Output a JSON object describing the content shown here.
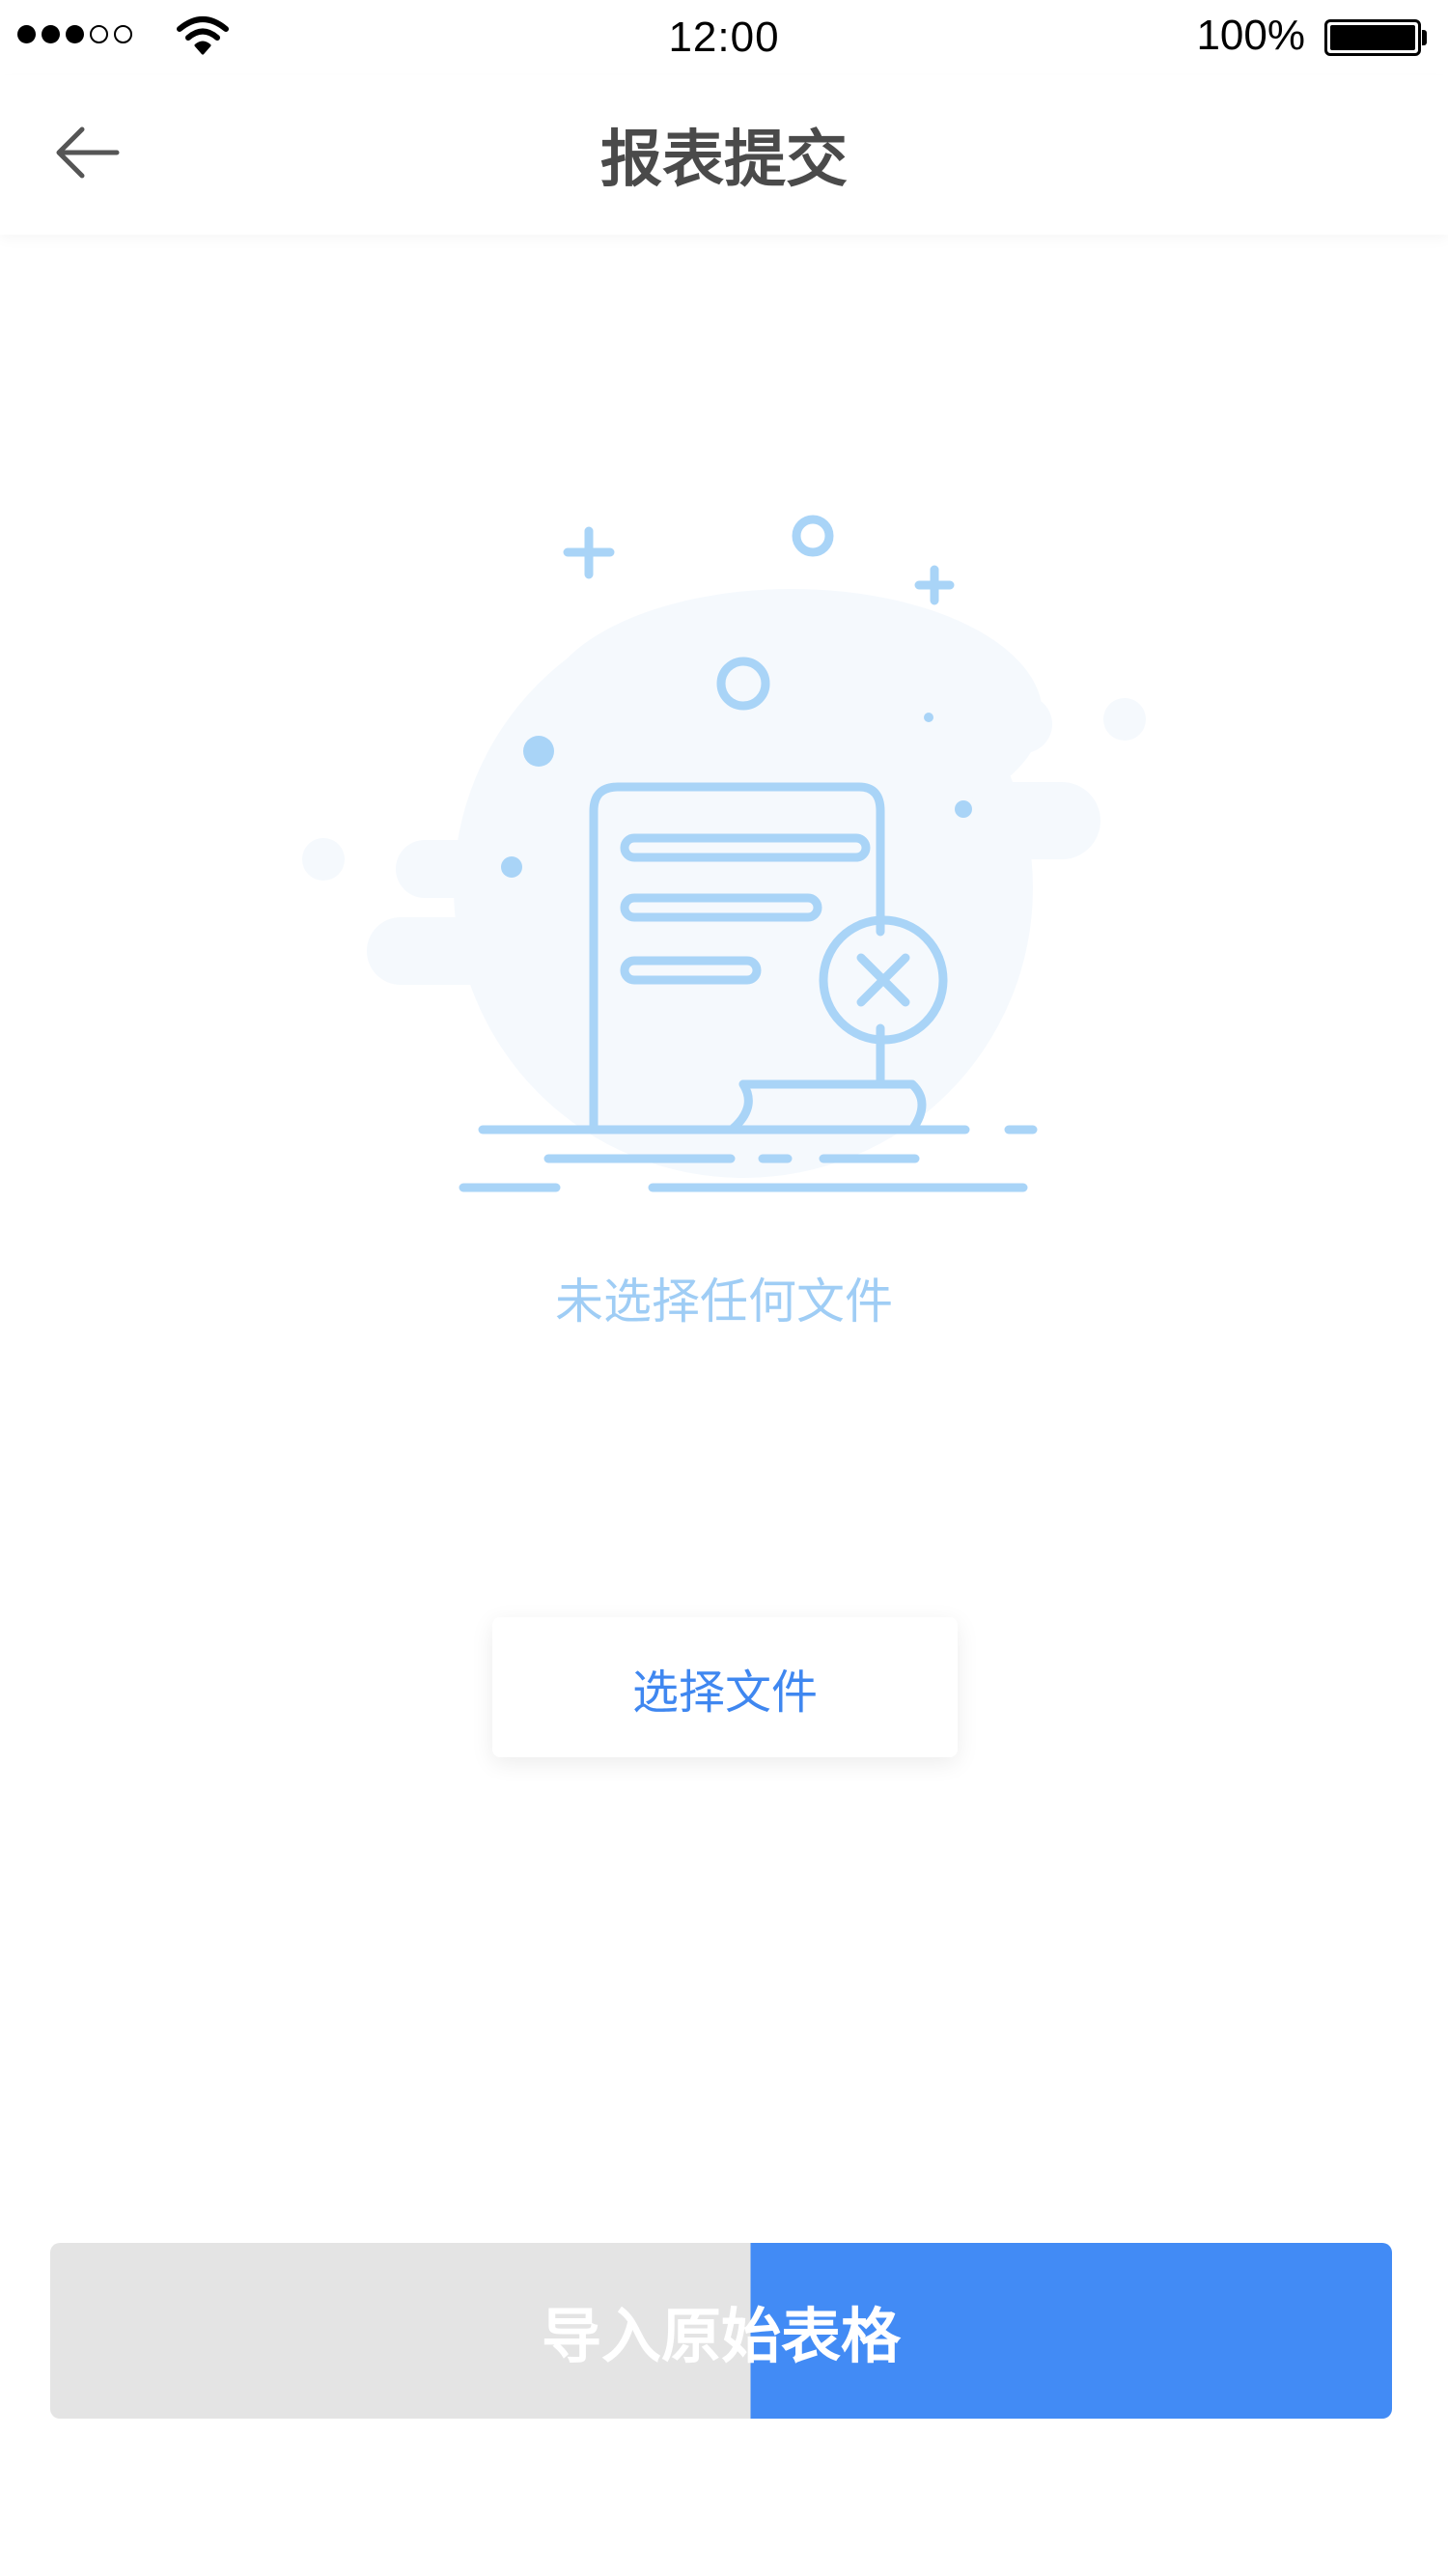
{
  "status_bar": {
    "time": "12:00",
    "battery_percent": "100%",
    "signal_bars_filled": 3,
    "signal_bars_total": 5,
    "battery_level": 1.0
  },
  "nav": {
    "title": "报表提交",
    "back_icon": "arrow-left-icon"
  },
  "empty_state": {
    "message": "未选择任何文件",
    "illustration_icon": "document-error-icon"
  },
  "actions": {
    "select_file_label": "选择文件",
    "import_label": "导入原始表格",
    "import_progress": 0.522
  },
  "colors": {
    "primary": "#428bf5",
    "link": "#3f87f0",
    "illustration": "#a9d4f7",
    "empty_text": "#9fcdf5",
    "disabled": "#e4e4e4"
  }
}
